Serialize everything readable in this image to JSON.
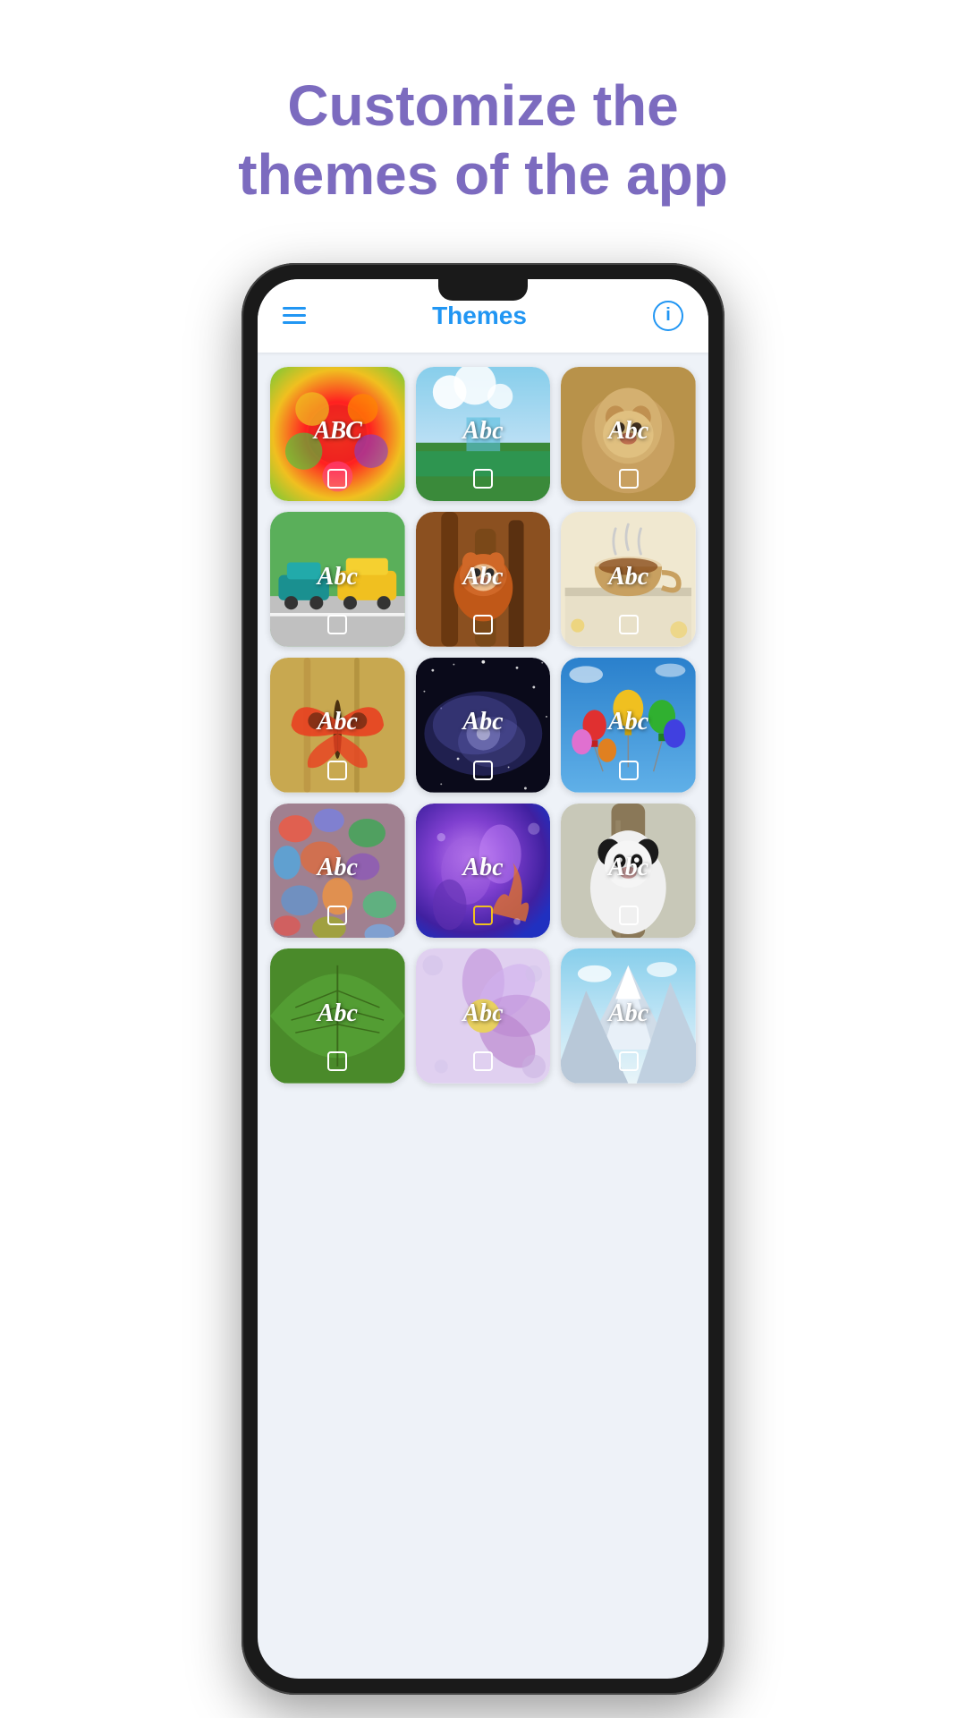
{
  "page": {
    "header_line1": "Customize the",
    "header_line2": "themes of the app"
  },
  "appbar": {
    "title": "Themes",
    "info_symbol": "i"
  },
  "themes": [
    {
      "id": "fruit",
      "label": "ABC",
      "bg": "fruit",
      "label_style": "bold"
    },
    {
      "id": "lake",
      "label": "Abc",
      "bg": "lake",
      "label_style": "normal"
    },
    {
      "id": "lion",
      "label": "Abc",
      "bg": "lion",
      "label_style": "normal"
    },
    {
      "id": "cars",
      "label": "Abc",
      "bg": "cars",
      "label_style": "normal"
    },
    {
      "id": "redpanda",
      "label": "Abc",
      "bg": "redpanda",
      "label_style": "normal"
    },
    {
      "id": "tea",
      "label": "Abc",
      "bg": "tea",
      "label_style": "normal"
    },
    {
      "id": "butterfly",
      "label": "Abc",
      "bg": "butterfly",
      "label_style": "normal"
    },
    {
      "id": "galaxy",
      "label": "Abc",
      "bg": "galaxy",
      "label_style": "normal"
    },
    {
      "id": "balloon",
      "label": "Abc",
      "bg": "balloon",
      "label_style": "script"
    },
    {
      "id": "stones",
      "label": "Abc",
      "bg": "stones",
      "label_style": "normal"
    },
    {
      "id": "purple",
      "label": "Abc",
      "bg": "purple",
      "label_style": "normal"
    },
    {
      "id": "panda",
      "label": "Abc",
      "bg": "panda",
      "label_style": "normal"
    },
    {
      "id": "leaf",
      "label": "Abc",
      "bg": "leaf",
      "label_style": "script"
    },
    {
      "id": "flower",
      "label": "Abc",
      "bg": "flower",
      "label_style": "script"
    },
    {
      "id": "mountain",
      "label": "Abc",
      "bg": "mountain",
      "label_style": "normal"
    }
  ]
}
